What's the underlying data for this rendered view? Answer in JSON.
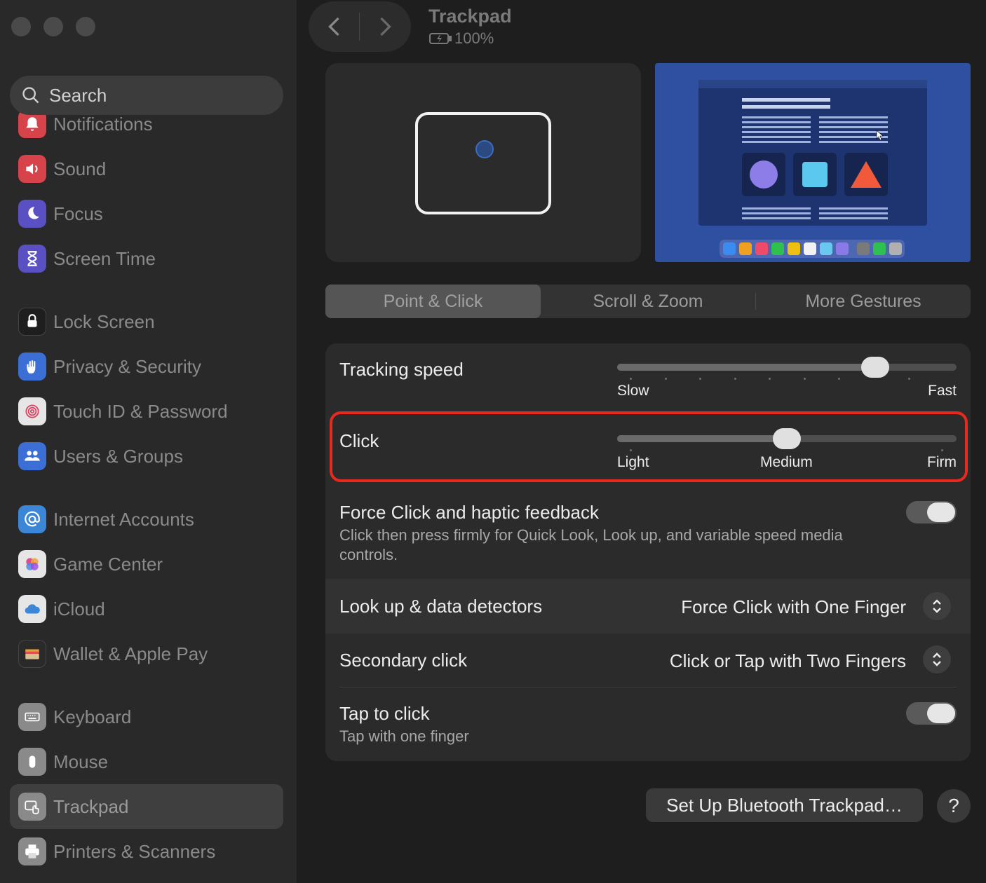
{
  "sidebar": {
    "search_placeholder": "Search",
    "items": [
      {
        "label": "Notifications",
        "icon": "bell-icon",
        "color": "#d6434a"
      },
      {
        "label": "Sound",
        "icon": "speaker-icon",
        "color": "#d6434a"
      },
      {
        "label": "Focus",
        "icon": "moon-icon",
        "color": "#5b4fc4"
      },
      {
        "label": "Screen Time",
        "icon": "hourglass-icon",
        "color": "#5b4fc4"
      },
      {
        "label": "Lock Screen",
        "icon": "lock-icon",
        "color": "#1e1e1e"
      },
      {
        "label": "Privacy & Security",
        "icon": "hand-icon",
        "color": "#3b6fd6"
      },
      {
        "label": "Touch ID & Password",
        "icon": "fingerprint-icon",
        "color": "#e6e6e6"
      },
      {
        "label": "Users & Groups",
        "icon": "users-icon",
        "color": "#3b6fd6"
      },
      {
        "label": "Internet Accounts",
        "icon": "at-icon",
        "color": "#3b86d6"
      },
      {
        "label": "Game Center",
        "icon": "game-center-icon",
        "color": "#e6e6e6"
      },
      {
        "label": "iCloud",
        "icon": "cloud-icon",
        "color": "#e6e6e6"
      },
      {
        "label": "Wallet & Apple Pay",
        "icon": "wallet-icon",
        "color": "#2a2a2a"
      },
      {
        "label": "Keyboard",
        "icon": "keyboard-icon",
        "color": "#8a8a8a"
      },
      {
        "label": "Mouse",
        "icon": "mouse-icon",
        "color": "#8a8a8a"
      },
      {
        "label": "Trackpad",
        "icon": "trackpad-icon",
        "color": "#8a8a8a",
        "selected": true
      },
      {
        "label": "Printers & Scanners",
        "icon": "printer-icon",
        "color": "#8a8a8a"
      }
    ]
  },
  "header": {
    "title": "Trackpad",
    "battery": "100%"
  },
  "tabs": [
    {
      "label": "Point & Click",
      "active": true
    },
    {
      "label": "Scroll & Zoom",
      "active": false
    },
    {
      "label": "More Gestures",
      "active": false
    }
  ],
  "settings": {
    "tracking": {
      "label": "Tracking speed",
      "min_label": "Slow",
      "max_label": "Fast",
      "value": 0.76
    },
    "click": {
      "label": "Click",
      "min_label": "Light",
      "mid_label": "Medium",
      "max_label": "Firm",
      "value": 0.5
    },
    "force_click": {
      "label": "Force Click and haptic feedback",
      "description": "Click then press firmly for Quick Look, Look up, and variable speed media controls.",
      "enabled": true
    },
    "lookup": {
      "label": "Look up & data detectors",
      "value": "Force Click with One Finger"
    },
    "secondary": {
      "label": "Secondary click",
      "value": "Click or Tap with Two Fingers"
    },
    "tap": {
      "label": "Tap to click",
      "description": "Tap with one finger",
      "enabled": true
    }
  },
  "buttons": {
    "setup": "Set Up Bluetooth Trackpad…",
    "help": "?"
  },
  "colors": {
    "highlight": "#e8291e",
    "preview_bg": "#2f4fa0"
  }
}
